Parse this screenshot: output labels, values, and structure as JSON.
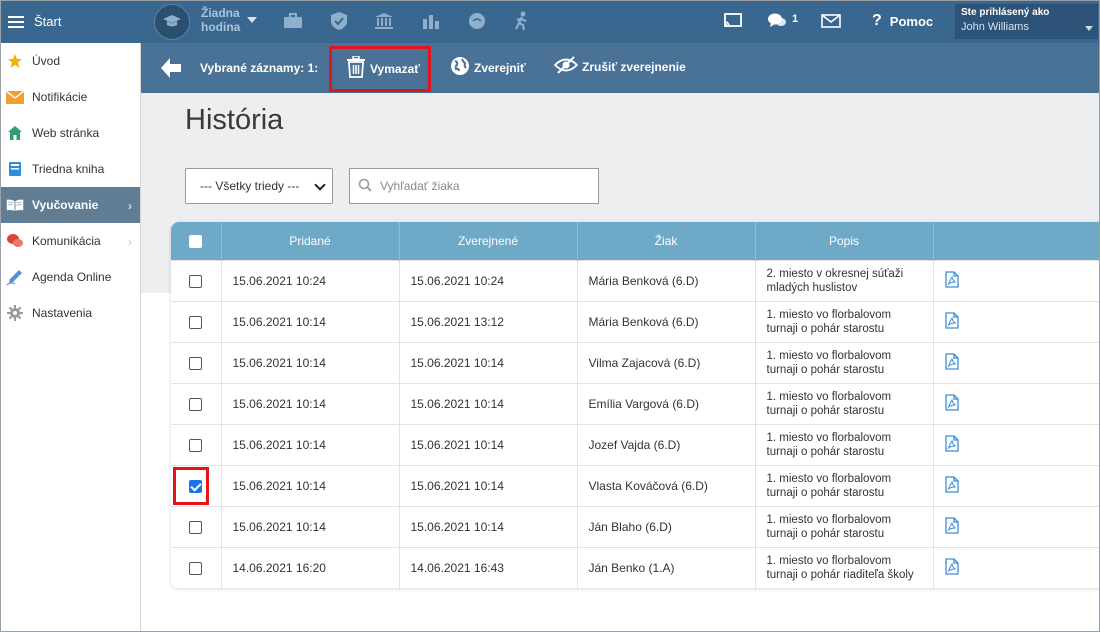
{
  "topbar": {
    "start_label": "Štart",
    "no_lesson_line1": "Žiadna",
    "no_lesson_line2": "hodina",
    "message_count": "1",
    "help_label": "Pomoc",
    "logged_in_label": "Ste prihlásený ako",
    "user_name": "John Williams"
  },
  "sidebar": {
    "items": [
      {
        "label": "Úvod",
        "icon": "star-icon",
        "color": "#f0b400"
      },
      {
        "label": "Notifikácie",
        "icon": "envelope-icon",
        "color": "#f0a030"
      },
      {
        "label": "Web stránka",
        "icon": "home-icon",
        "color": "#2f9e6e"
      },
      {
        "label": "Triedna kniha",
        "icon": "book-icon",
        "color": "#2a8fd6"
      },
      {
        "label": "Vyučovanie",
        "icon": "open-book-icon",
        "active": true
      },
      {
        "label": "Komunikácia",
        "icon": "chat-icon",
        "color": "#d9453b"
      },
      {
        "label": "Agenda Online",
        "icon": "pen-icon",
        "color": "#5a8fd0"
      },
      {
        "label": "Nastavenia",
        "icon": "gear-icon",
        "color": "#9a9a9a"
      }
    ]
  },
  "actionbar": {
    "selected_label": "Vybrané záznamy: 1:",
    "delete_label": "Vymazať",
    "publish_label": "Zverejniť",
    "unpublish_label": "Zrušiť zverejnenie"
  },
  "page": {
    "title": "História",
    "class_select_value": "--- Všetky triedy ---",
    "search_placeholder": "Vyhľadať žiaka"
  },
  "table": {
    "headers": [
      "Pridané",
      "Zverejnené",
      "Žiak",
      "Popis"
    ],
    "rows": [
      {
        "added": "15.06.2021 10:24",
        "published": "15.06.2021 10:24",
        "student": "Mária Benková (6.D)",
        "desc1": "2. miesto v okresnej súťaži",
        "desc2": "mladých huslistov",
        "checked": false
      },
      {
        "added": "15.06.2021 10:14",
        "published": "15.06.2021 13:12",
        "student": "Mária Benková (6.D)",
        "desc1": "1. miesto vo florbalovom",
        "desc2": "turnaji o pohár starostu",
        "checked": false
      },
      {
        "added": "15.06.2021 10:14",
        "published": "15.06.2021 10:14",
        "student": "Vilma Zajacová (6.D)",
        "desc1": "1. miesto vo florbalovom",
        "desc2": "turnaji o pohár starostu",
        "checked": false
      },
      {
        "added": "15.06.2021 10:14",
        "published": "15.06.2021 10:14",
        "student": "Emília Vargová (6.D)",
        "desc1": "1. miesto vo florbalovom",
        "desc2": "turnaji o pohár starostu",
        "checked": false
      },
      {
        "added": "15.06.2021 10:14",
        "published": "15.06.2021 10:14",
        "student": "Jozef Vajda (6.D)",
        "desc1": "1. miesto vo florbalovom",
        "desc2": "turnaji o pohár starostu",
        "checked": false
      },
      {
        "added": "15.06.2021 10:14",
        "published": "15.06.2021 10:14",
        "student": "Vlasta Kováčová (6.D)",
        "desc1": "1. miesto vo florbalovom",
        "desc2": "turnaji o pohár starostu",
        "checked": true
      },
      {
        "added": "15.06.2021 10:14",
        "published": "15.06.2021 10:14",
        "student": "Ján Blaho (6.D)",
        "desc1": "1. miesto vo florbalovom",
        "desc2": "turnaji o pohár starostu",
        "checked": false
      },
      {
        "added": "14.06.2021 16:20",
        "published": "14.06.2021 16:43",
        "student": "Ján Benko (1.A)",
        "desc1": "1. miesto vo florbalovom",
        "desc2": "turnaji o pohár riaditeľa školy",
        "checked": false
      }
    ]
  },
  "colors": {
    "topbar": "#39678f",
    "actionbar": "#4a7196",
    "table_header": "#6fa9c8",
    "highlight": "#e3141b",
    "sidebar_active": "#617d94"
  }
}
